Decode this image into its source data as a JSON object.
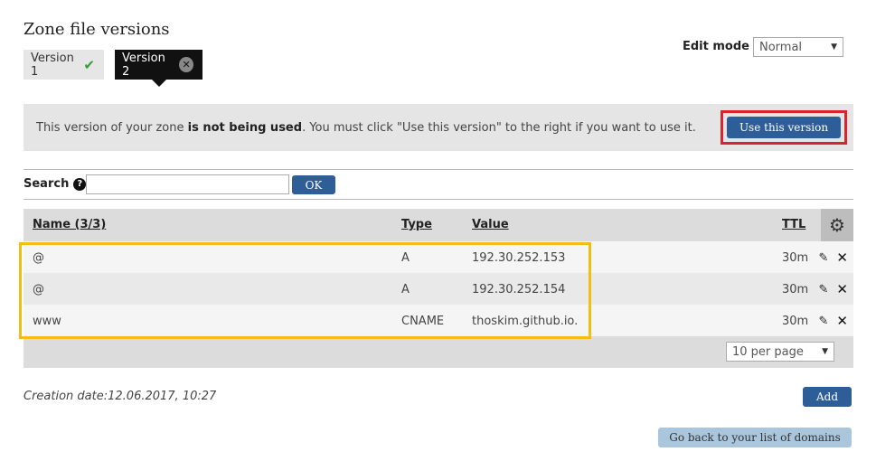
{
  "page": {
    "title": "Zone file versions"
  },
  "versions": [
    {
      "label": "Version 1",
      "status": "active"
    },
    {
      "label": "Version 2",
      "status": "selected"
    }
  ],
  "edit_mode": {
    "label": "Edit mode",
    "value": "Normal"
  },
  "notice": {
    "text_before": "This version of your zone ",
    "text_bold": "is not being used",
    "text_after": ". You must click \"Use this version\" to the right if you want to use it.",
    "button_label": "Use this version"
  },
  "search": {
    "label": "Search",
    "value": "",
    "ok_label": "OK"
  },
  "table": {
    "headers": {
      "name": "Name",
      "count": "(3/3)",
      "type": "Type",
      "value": "Value",
      "ttl": "TTL"
    },
    "rows": [
      {
        "name": "@",
        "type": "A",
        "value": "192.30.252.153",
        "ttl": "30m"
      },
      {
        "name": "@",
        "type": "A",
        "value": "192.30.252.154",
        "ttl": "30m"
      },
      {
        "name": "www",
        "type": "CNAME",
        "value": "thoskim.github.io.",
        "ttl": "30m"
      }
    ],
    "per_page": "10 per page"
  },
  "footer": {
    "creation_label": "Creation date:",
    "creation_value": "12.06.2017, 10:27",
    "add_label": "Add",
    "back_label": "Go back to your list of domains"
  },
  "colors": {
    "primary_button": "#2e5e98",
    "highlight_red": "#d9232e",
    "highlight_yellow": "#f4bd14",
    "success_check": "#3a9a3a"
  }
}
